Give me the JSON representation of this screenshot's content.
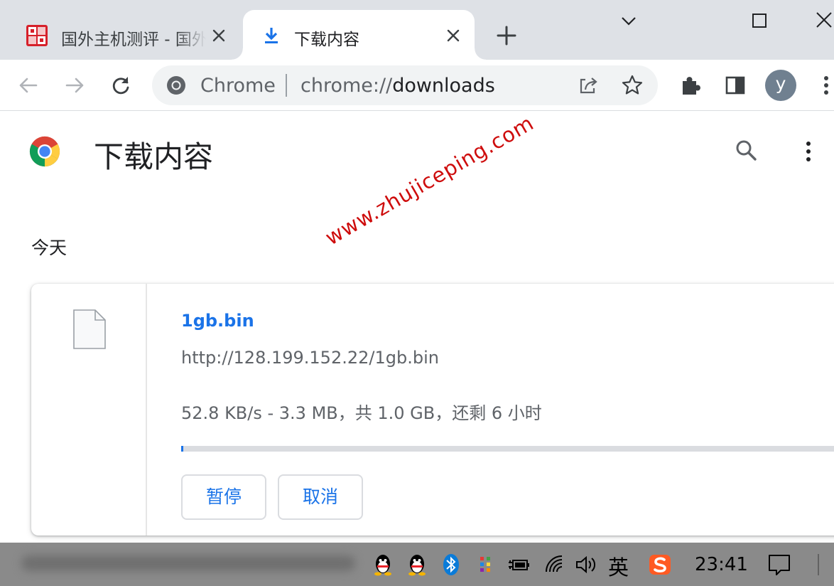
{
  "tabs": [
    {
      "title": "国外主机测评 - 国外",
      "active": false,
      "favicon": "site-logo-icon"
    },
    {
      "title": "下载内容",
      "active": true,
      "favicon": "download-icon"
    }
  ],
  "toolbar": {
    "chip_label": "Chrome",
    "url_scheme": "chrome://",
    "url_path": "downloads",
    "avatar_letter": "y"
  },
  "page": {
    "title": "下载内容",
    "date_heading": "今天"
  },
  "download": {
    "file_name": "1gb.bin",
    "url": "http://128.199.152.22/1gb.bin",
    "status": "52.8 KB/s - 3.3 MB，共 1.0 GB，还剩 6 小时",
    "progress_fraction": 0.0033,
    "pause_label": "暂停",
    "cancel_label": "取消"
  },
  "watermark": "www.zhujiceping.com",
  "taskbar": {
    "ime_label": "英",
    "time": "23:41"
  },
  "colors": {
    "accent": "#1a73e8",
    "tabstrip": "#dee1e6",
    "omnibox": "#f1f3f4",
    "watermark": "#cc0000",
    "taskbar": "#8a8a8a"
  }
}
